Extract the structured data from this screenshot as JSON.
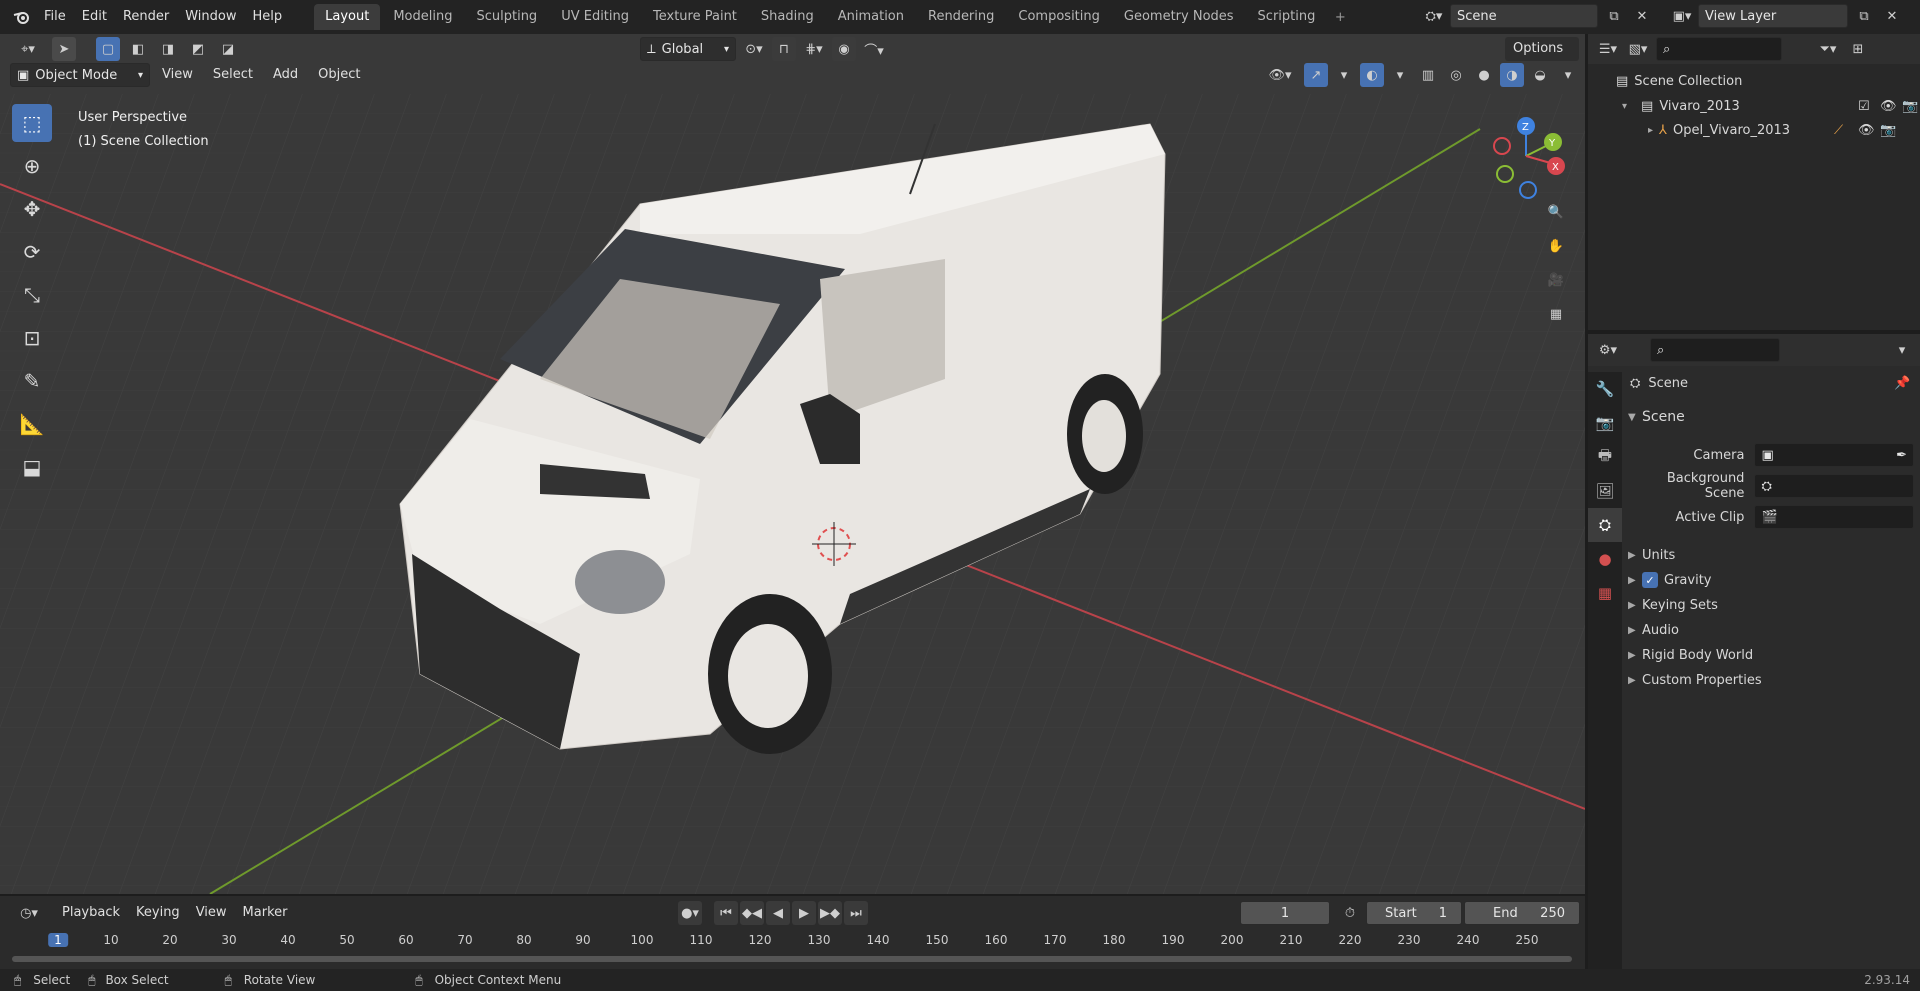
{
  "app": {
    "version": "2.93.14"
  },
  "menu": [
    "File",
    "Edit",
    "Render",
    "Window",
    "Help"
  ],
  "workspaces": [
    "Layout",
    "Modeling",
    "Sculpting",
    "UV Editing",
    "Texture Paint",
    "Shading",
    "Animation",
    "Rendering",
    "Compositing",
    "Geometry Nodes",
    "Scripting"
  ],
  "active_workspace": "Layout",
  "scene_field": "Scene",
  "view_layer_field": "View Layer",
  "viewport": {
    "mode": "Object Mode",
    "menus": [
      "View",
      "Select",
      "Add",
      "Object"
    ],
    "transform_orientation": "Global",
    "options_label": "Options",
    "overlay_line1": "User Perspective",
    "overlay_line2": "(1) Scene Collection",
    "gizmo": {
      "x": "X",
      "y": "Y",
      "z": "Z"
    }
  },
  "outliner": {
    "root": "Scene Collection",
    "items": [
      {
        "label": "Vivaro_2013",
        "depth": 1
      },
      {
        "label": "Opel_Vivaro_2013",
        "depth": 2
      }
    ]
  },
  "properties": {
    "context_label": "Scene",
    "panel_title": "Scene",
    "camera_label": "Camera",
    "background_scene_label": "Background Scene",
    "active_clip_label": "Active Clip",
    "collapsed_panels": [
      "Units",
      "Gravity",
      "Keying Sets",
      "Audio",
      "Rigid Body World",
      "Custom Properties"
    ],
    "gravity_checked": true
  },
  "timeline": {
    "menus": [
      "Playback",
      "Keying",
      "View",
      "Marker"
    ],
    "current_frame": "1",
    "start_label": "Start",
    "start_value": "1",
    "end_label": "End",
    "end_value": "250",
    "ruler": [
      "1",
      "10",
      "20",
      "30",
      "40",
      "50",
      "60",
      "70",
      "80",
      "90",
      "100",
      "110",
      "120",
      "130",
      "140",
      "150",
      "160",
      "170",
      "180",
      "190",
      "200",
      "210",
      "220",
      "230",
      "240",
      "250"
    ]
  },
  "status": {
    "select": "Select",
    "box_select": "Box Select",
    "rotate_view": "Rotate View",
    "context_menu": "Object Context Menu"
  },
  "colors": {
    "accent": "#4772b3",
    "x_axis": "#d8474f",
    "y_axis": "#8bbd35",
    "z_axis": "#3f82e0",
    "bg": "#393939"
  }
}
